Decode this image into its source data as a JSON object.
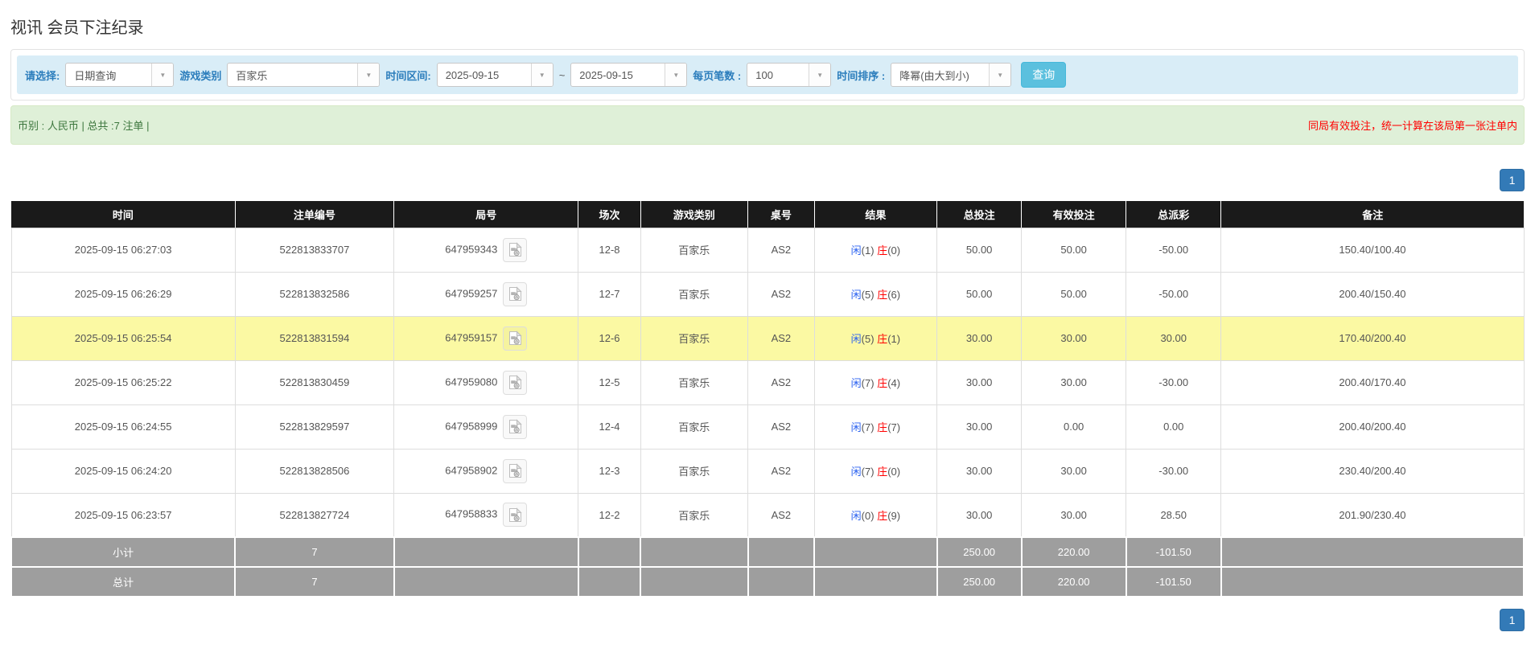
{
  "page": {
    "title": "视讯 会员下注纪录"
  },
  "filter": {
    "query_type_label": "请选择:",
    "query_type_value": "日期查询",
    "game_type_label": "游戏类别",
    "game_type_value": "百家乐",
    "date_range_label": "时间区间:",
    "date_from": "2025-09-15",
    "date_separator": "~",
    "date_to": "2025-09-15",
    "page_size_label": "每页笔数 :",
    "page_size_value": "100",
    "sort_label": "时间排序 :",
    "sort_value": "降幂(由大到小)",
    "search_button_label": "查询"
  },
  "summary": {
    "currency_total_text": "币别 : 人民币 | 总共 :7 注单 |",
    "note_text": "同局有效投注，统一计算在该局第一张注单内"
  },
  "pagination": {
    "current_page": "1"
  },
  "table": {
    "headers": [
      "时间",
      "注单编号",
      "局号",
      "场次",
      "游戏类别",
      "桌号",
      "结果",
      "总投注",
      "有效投注",
      "总派彩",
      "备注"
    ],
    "column_widths": [
      "14.8%",
      "10.5%",
      "12.2%",
      "4.1%",
      "7.1%",
      "4.4%",
      "8.1%",
      "5.6%",
      "6.9%",
      "6.3%",
      "20%"
    ],
    "video_icon_name": "video-replay-icon",
    "rows": [
      {
        "time": "2025-09-15 06:27:03",
        "bet_id": "522813833707",
        "round_id": "647959343",
        "session": "12-8",
        "game": "百家乐",
        "table_no": "AS2",
        "player_label": "闲",
        "player_score": "(1)",
        "banker_label": "庄",
        "banker_score": "(0)",
        "total_bet": "50.00",
        "valid_bet": "50.00",
        "payout": "-50.00",
        "remark": "150.40/100.40",
        "highlight": false
      },
      {
        "time": "2025-09-15 06:26:29",
        "bet_id": "522813832586",
        "round_id": "647959257",
        "session": "12-7",
        "game": "百家乐",
        "table_no": "AS2",
        "player_label": "闲",
        "player_score": "(5)",
        "banker_label": "庄",
        "banker_score": "(6)",
        "total_bet": "50.00",
        "valid_bet": "50.00",
        "payout": "-50.00",
        "remark": "200.40/150.40",
        "highlight": false
      },
      {
        "time": "2025-09-15 06:25:54",
        "bet_id": "522813831594",
        "round_id": "647959157",
        "session": "12-6",
        "game": "百家乐",
        "table_no": "AS2",
        "player_label": "闲",
        "player_score": "(5)",
        "banker_label": "庄",
        "banker_score": "(1)",
        "total_bet": "30.00",
        "valid_bet": "30.00",
        "payout": "30.00",
        "remark": "170.40/200.40",
        "highlight": true
      },
      {
        "time": "2025-09-15 06:25:22",
        "bet_id": "522813830459",
        "round_id": "647959080",
        "session": "12-5",
        "game": "百家乐",
        "table_no": "AS2",
        "player_label": "闲",
        "player_score": "(7)",
        "banker_label": "庄",
        "banker_score": "(4)",
        "total_bet": "30.00",
        "valid_bet": "30.00",
        "payout": "-30.00",
        "remark": "200.40/170.40",
        "highlight": false
      },
      {
        "time": "2025-09-15 06:24:55",
        "bet_id": "522813829597",
        "round_id": "647958999",
        "session": "12-4",
        "game": "百家乐",
        "table_no": "AS2",
        "player_label": "闲",
        "player_score": "(7)",
        "banker_label": "庄",
        "banker_score": "(7)",
        "total_bet": "30.00",
        "valid_bet": "0.00",
        "payout": "0.00",
        "remark": "200.40/200.40",
        "highlight": false
      },
      {
        "time": "2025-09-15 06:24:20",
        "bet_id": "522813828506",
        "round_id": "647958902",
        "session": "12-3",
        "game": "百家乐",
        "table_no": "AS2",
        "player_label": "闲",
        "player_score": "(7)",
        "banker_label": "庄",
        "banker_score": "(0)",
        "total_bet": "30.00",
        "valid_bet": "30.00",
        "payout": "-30.00",
        "remark": "230.40/200.40",
        "highlight": false
      },
      {
        "time": "2025-09-15 06:23:57",
        "bet_id": "522813827724",
        "round_id": "647958833",
        "session": "12-2",
        "game": "百家乐",
        "table_no": "AS2",
        "player_label": "闲",
        "player_score": "(0)",
        "banker_label": "庄",
        "banker_score": "(9)",
        "total_bet": "30.00",
        "valid_bet": "30.00",
        "payout": "28.50",
        "remark": "201.90/230.40",
        "highlight": false
      }
    ],
    "footer_rows": [
      {
        "label": "小计",
        "count": "7",
        "total_bet": "250.00",
        "valid_bet": "220.00",
        "payout": "-101.50"
      },
      {
        "label": "总计",
        "count": "7",
        "total_bet": "250.00",
        "valid_bet": "220.00",
        "payout": "-101.50"
      }
    ]
  },
  "colors": {
    "header_bg": "#1a1a1a",
    "row_highlight": "#fbf9a3",
    "footer_bg": "#9e9e9e",
    "filter_bar_bg": "#d9edf7",
    "filter_label_blue": "#2b7dbc",
    "summary_bg": "#dff0d8",
    "summary_text_green": "#3c763d",
    "note_red": "#ff0000",
    "bet_amount_blue": "#3d6fd7",
    "player_blue": "#2b62f0",
    "banker_red": "#ff0000",
    "search_button_bg": "#5bc0de",
    "pager_active_bg": "#337ab7"
  }
}
